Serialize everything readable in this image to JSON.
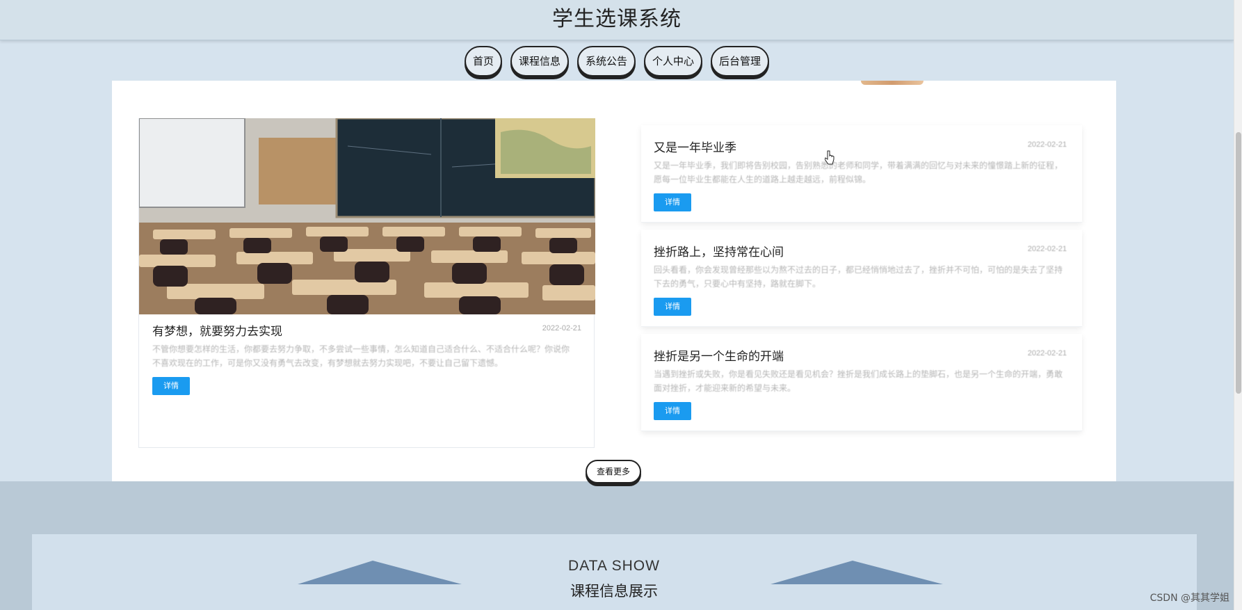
{
  "header": {
    "title": "学生选课系统"
  },
  "nav": {
    "items": [
      "首页",
      "课程信息",
      "系统公告",
      "个人中心",
      "后台管理"
    ]
  },
  "featured": {
    "title": "有梦想，就要努力去实现",
    "date": "2022-02-21",
    "excerpt": "不管你想要怎样的生活，你都要去努力争取，不多尝试一些事情，怎么知道自己适合什么、不适合什么呢？你说你不喜欢现在的工作，可是你又没有勇气去改变，有梦想就去努力实现吧，不要让自己留下遗憾。",
    "detail_label": "详情"
  },
  "news": [
    {
      "title": "又是一年毕业季",
      "date": "2022-02-21",
      "excerpt": "又是一年毕业季，我们即将告别校园，告别熟悉的老师和同学，带着满满的回忆与对未来的憧憬踏上新的征程，愿每一位毕业生都能在人生的道路上越走越远，前程似锦。",
      "detail_label": "详情"
    },
    {
      "title": "挫折路上，坚持常在心间",
      "date": "2022-02-21",
      "excerpt": "回头看看，你会发现曾经那些以为熬不过去的日子，都已经悄悄地过去了，挫折并不可怕，可怕的是失去了坚持下去的勇气，只要心中有坚持，路就在脚下。",
      "detail_label": "详情"
    },
    {
      "title": "挫折是另一个生命的开端",
      "date": "2022-02-21",
      "excerpt": "当遇到挫折或失败，你是看见失败还是看见机会？挫折是我们成长路上的垫脚石，也是另一个生命的开端，勇敢面对挫折，才能迎来新的希望与未来。",
      "detail_label": "详情"
    }
  ],
  "more_label": "查看更多",
  "data_section": {
    "title_en": "DATA SHOW",
    "title_cn": "课程信息展示"
  },
  "watermark": "CSDN @其其学姐",
  "colors": {
    "page_bg": "#d6e3ee",
    "accent": "#1a9bf0",
    "band": "#b9c9d6"
  }
}
